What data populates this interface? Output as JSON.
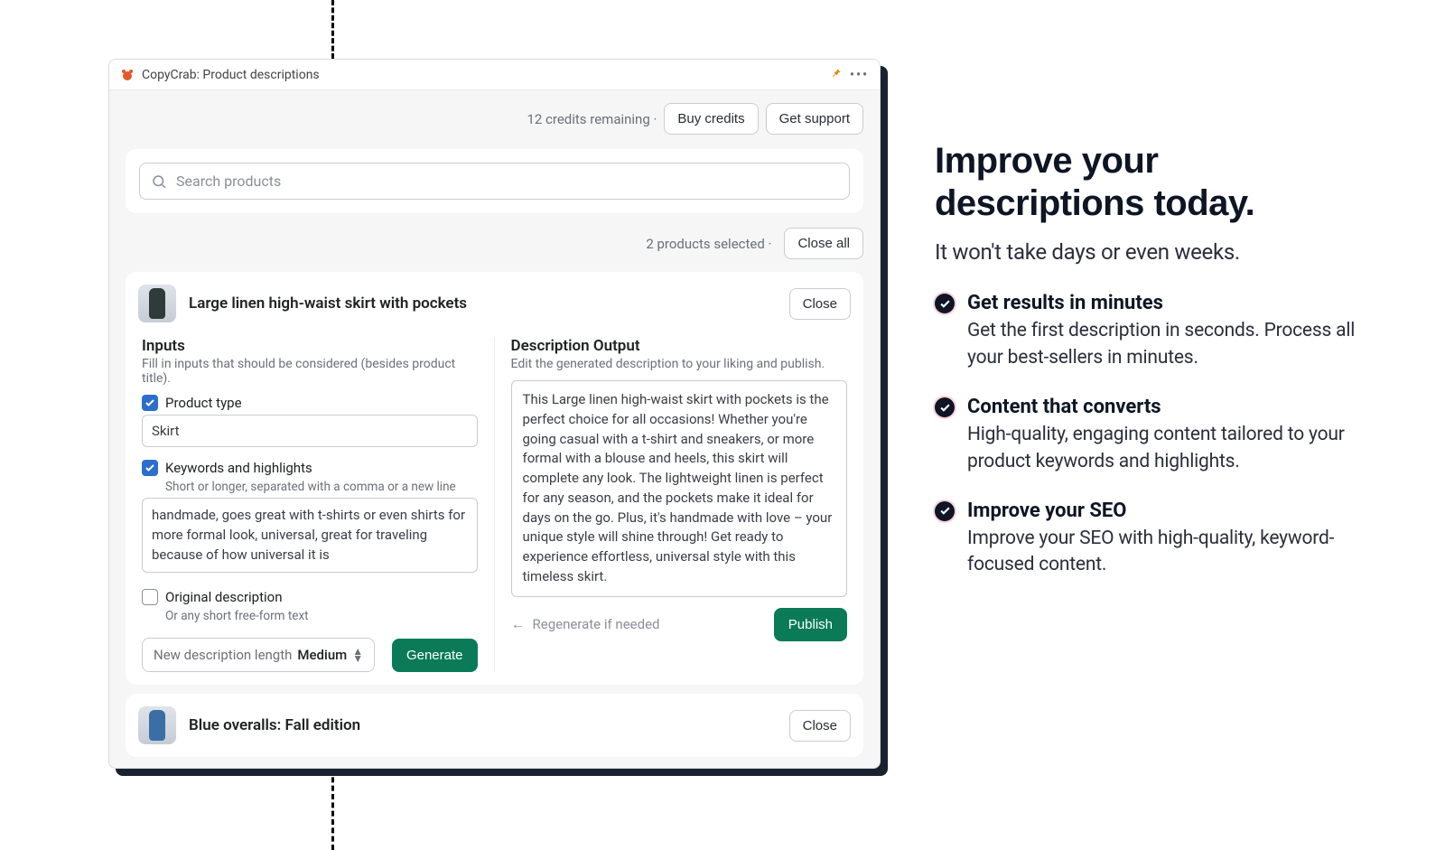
{
  "title": "CopyCrab: Product descriptions",
  "topbar": {
    "credits_text": "12 credits remaining  ·",
    "buy_credits": "Buy credits",
    "get_support": "Get support"
  },
  "search": {
    "placeholder": "Search products"
  },
  "selection": {
    "count_text": "2 products selected  ·",
    "close_all": "Close all"
  },
  "product1": {
    "name": "Large linen high-waist skirt with pockets",
    "close": "Close",
    "inputs_title": "Inputs",
    "inputs_sub": "Fill in inputs that should be considered (besides product title).",
    "pt_label": "Product type",
    "pt_value": "Skirt",
    "kw_label": "Keywords and highlights",
    "kw_hint": "Short or longer, separated with a comma or a new line",
    "kw_value": "handmade, goes great with t-shirts or even shirts for more formal look, universal, great for traveling because of how universal it is",
    "orig_label": "Original description",
    "orig_hint": "Or any short free-form text",
    "length_prefix": "New description length",
    "length_value": "Medium",
    "generate": "Generate",
    "output_title": "Description Output",
    "output_sub": "Edit the generated description to your liking and publish.",
    "output_text": "This Large linen high-waist skirt with pockets is the perfect choice for all occasions! Whether you're going casual with a t-shirt and sneakers, or more formal with a blouse and heels, this skirt will complete any look. The lightweight linen is perfect for any season, and the pockets make it ideal for days on the go. Plus, it's handmade with love – your unique style will shine through! Get ready to experience effortless, universal style with this timeless skirt.",
    "regen": "Regenerate if needed",
    "publish": "Publish"
  },
  "product2": {
    "name": "Blue overalls: Fall edition",
    "close": "Close"
  },
  "promo": {
    "heading": "Improve your descriptions today.",
    "sub": "It won't take days or even weeks.",
    "bullets": [
      {
        "title": "Get results in minutes",
        "body": "Get the first description in seconds. Process all your best-sellers in minutes."
      },
      {
        "title": "Content that converts",
        "body": "High-quality, engaging content tailored to your product keywords and highlights."
      },
      {
        "title": "Improve your SEO",
        "body": "Improve your SEO with high-quality, keyword-focused content."
      }
    ]
  }
}
